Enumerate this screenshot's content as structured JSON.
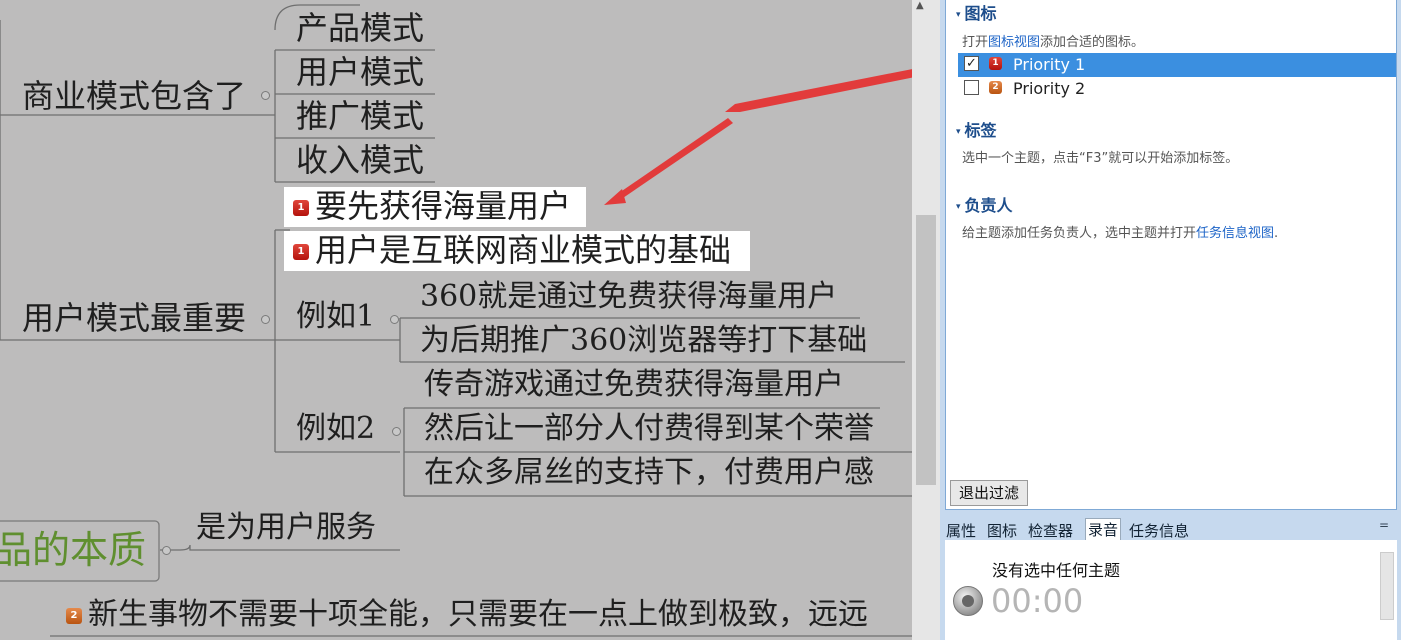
{
  "mindmap": {
    "business_model": "商业模式包含了",
    "bm_children": [
      "产品模式",
      "用户模式",
      "推广模式",
      "收入模式"
    ],
    "user_model_key": "用户模式最重要",
    "note_1": "要先获得海量用户",
    "note_2": "用户是互联网商业模式的基础",
    "eg1": "例如1",
    "eg1_items": [
      "360就是通过免费获得海量用户",
      "为后期推广360浏览器等打下基础"
    ],
    "eg2": "例如2",
    "eg2_items": [
      "传奇游戏通过免费获得海量用户",
      "然后让一部分人付费得到某个荣誉",
      "在众多屌丝的支持下，付费用户感"
    ],
    "product_essence": "品的本质",
    "serve_users": "是为用户服务",
    "new_things": "新生事物不需要十项全能，只需要在一点上做到极致，远远",
    "priority_marker_1": "1",
    "priority_marker_2": "2"
  },
  "panel": {
    "icons_section": {
      "title": "图标",
      "desc_prefix": "打开",
      "desc_link": "图标视图",
      "desc_suffix": "添加合适的图标。",
      "items": [
        {
          "label": "Priority 1",
          "checked": true,
          "selected": true,
          "marker": "1"
        },
        {
          "label": "Priority 2",
          "checked": false,
          "selected": false,
          "marker": "2"
        }
      ]
    },
    "tags_section": {
      "title": "标签",
      "desc": "选中一个主题，点击“F3”就可以开始添加标签。"
    },
    "assignee_section": {
      "title": "负责人",
      "desc_prefix": "给主题添加任务负责人，选中主题并打开",
      "desc_link": "任务信息视图",
      "desc_suffix": "."
    },
    "exit_filter": "退出过滤",
    "tabs": [
      "属性",
      "图标",
      "检查器",
      "录音",
      "任务信息"
    ],
    "active_tab": "录音",
    "tab_menu": "=",
    "recording": {
      "status": "没有选中任何主题",
      "time": "00:00"
    }
  },
  "colors": {
    "canvas": "#bdbcbc",
    "annotation_arrow": "#e23b3b",
    "essence_text": "#5f8f2f",
    "selection_blue": "#3b8fe0",
    "section_title": "#1e4e8c"
  },
  "icons": [
    "priority-1-icon",
    "priority-2-icon",
    "checkbox-icon",
    "record-button-icon",
    "scroll-up-icon"
  ]
}
